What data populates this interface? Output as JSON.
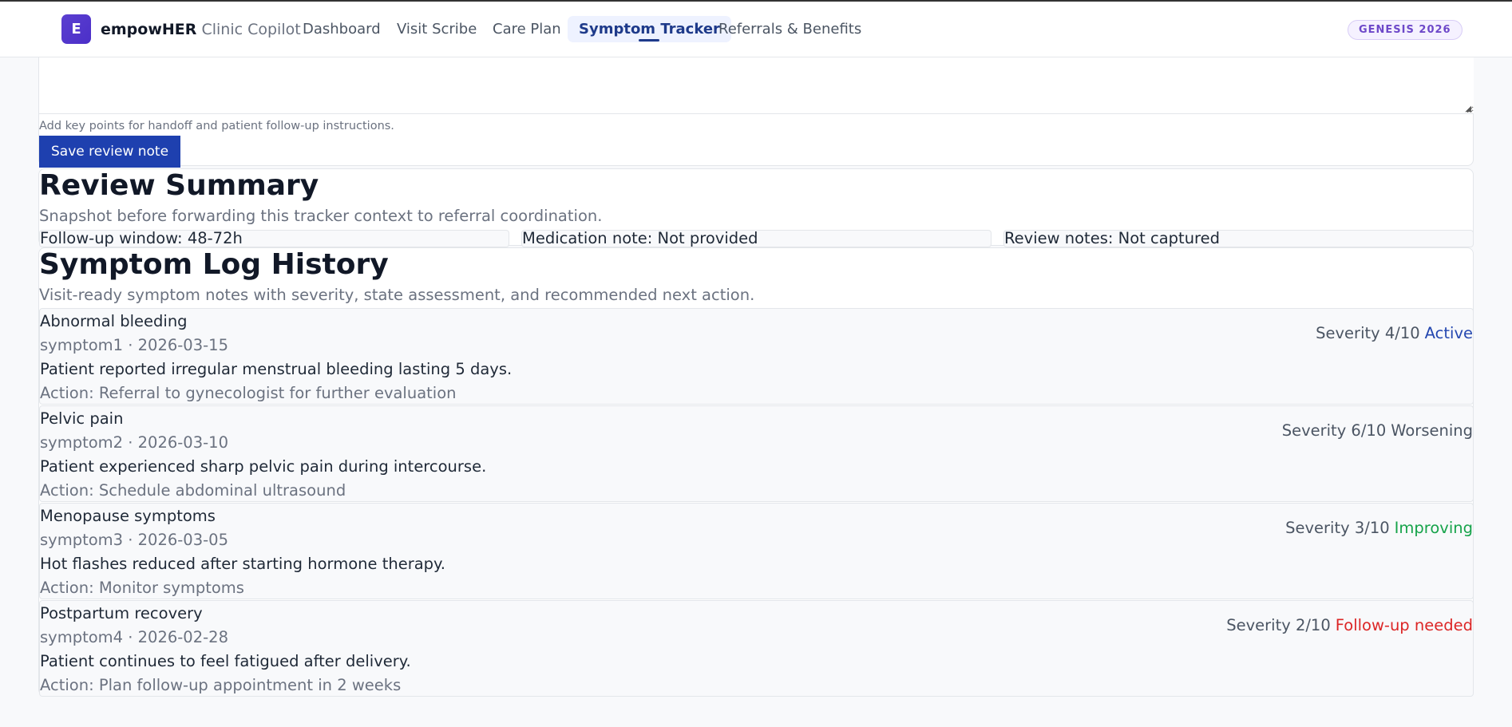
{
  "app": {
    "brand_initial": "E",
    "brand_name_bold": "empowHER",
    "brand_name_light": "Clinic Copilot",
    "badge": "GENESIS 2026"
  },
  "nav": {
    "tabs": [
      {
        "label": "Dashboard",
        "active": false
      },
      {
        "label": "Visit Scribe",
        "active": false
      },
      {
        "label": "Care Plan",
        "active": false
      },
      {
        "label": "Symptom Tracker",
        "active": true
      },
      {
        "label": "Referrals & Benefits",
        "active": false
      }
    ]
  },
  "review_note": {
    "value": "",
    "helper": "Add key points for handoff and patient follow-up instructions.",
    "save_label": "Save review note"
  },
  "summary": {
    "title": "Review Summary",
    "subtitle": "Snapshot before forwarding this tracker context to referral coordination.",
    "stats": [
      "Follow-up window: 48-72h",
      "Medication note: Not provided",
      "Review notes: Not captured"
    ]
  },
  "history": {
    "title": "Symptom Log History",
    "subtitle": "Visit-ready symptom notes with severity, state assessment, and recommended next action.",
    "entries": [
      {
        "title": "Abnormal bleeding",
        "meta": "symptom1 · 2026-03-15",
        "description": "Patient reported irregular menstrual bleeding lasting 5 days.",
        "action": "Action: Referral to gynecologist for further evaluation",
        "severity": "Severity 4/10",
        "state": "Active",
        "state_color": "#2548b0"
      },
      {
        "title": "Pelvic pain",
        "meta": "symptom2 · 2026-03-10",
        "description": "Patient experienced sharp pelvic pain during intercourse.",
        "action": "Action: Schedule abdominal ultrasound",
        "severity": "Severity 6/10",
        "state": "Worsening",
        "state_color": "#4b5563"
      },
      {
        "title": "Menopause symptoms",
        "meta": "symptom3 · 2026-03-05",
        "description": "Hot flashes reduced after starting hormone therapy.",
        "action": "Action: Monitor symptoms",
        "severity": "Severity 3/10",
        "state": "Improving",
        "state_color": "#16a34a"
      },
      {
        "title": "Postpartum recovery",
        "meta": "symptom4 · 2026-02-28",
        "description": "Patient continues to feel fatigued after delivery.",
        "action": "Action: Plan follow-up appointment in 2 weeks",
        "severity": "Severity 2/10",
        "state": "Follow-up needed",
        "state_color": "#dc2626"
      }
    ]
  }
}
